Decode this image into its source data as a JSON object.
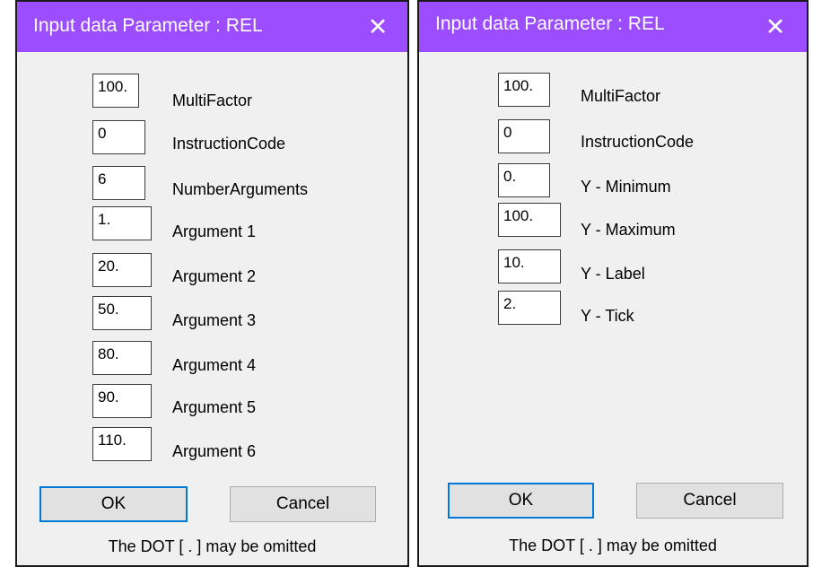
{
  "left_dialog": {
    "title": "Input data Parameter : REL",
    "close_glyph": "✕",
    "fields": [
      {
        "value": "100.",
        "label": "MultiFactor"
      },
      {
        "value": "0",
        "label": "InstructionCode"
      },
      {
        "value": "6",
        "label": "NumberArguments"
      },
      {
        "value": "1.",
        "label": "Argument 1"
      },
      {
        "value": "20.",
        "label": "Argument 2"
      },
      {
        "value": "50.",
        "label": "Argument 3"
      },
      {
        "value": "80.",
        "label": "Argument 4"
      },
      {
        "value": "90.",
        "label": "Argument 5"
      },
      {
        "value": "110.",
        "label": "Argument 6"
      }
    ],
    "ok_label": "OK",
    "cancel_label": "Cancel",
    "footer": "The DOT [ . ] may be omitted"
  },
  "right_dialog": {
    "title": "Input data Parameter : REL",
    "close_glyph": "✕",
    "fields": [
      {
        "value": "100.",
        "label": "MultiFactor"
      },
      {
        "value": "0",
        "label": "InstructionCode"
      },
      {
        "value": "0.",
        "label": "Y - Minimum"
      },
      {
        "value": "100.",
        "label": "Y - Maximum"
      },
      {
        "value": "10.",
        "label": "Y - Label"
      },
      {
        "value": "2.",
        "label": "Y - Tick"
      }
    ],
    "ok_label": "OK",
    "cancel_label": "Cancel",
    "footer": "The DOT [ . ] may be omitted"
  },
  "colors": {
    "titlebar": "#9b4dff",
    "dialog_bg": "#f0f0f0",
    "ok_focus_border": "#0078d7"
  },
  "icons": {
    "close": "close-icon"
  }
}
